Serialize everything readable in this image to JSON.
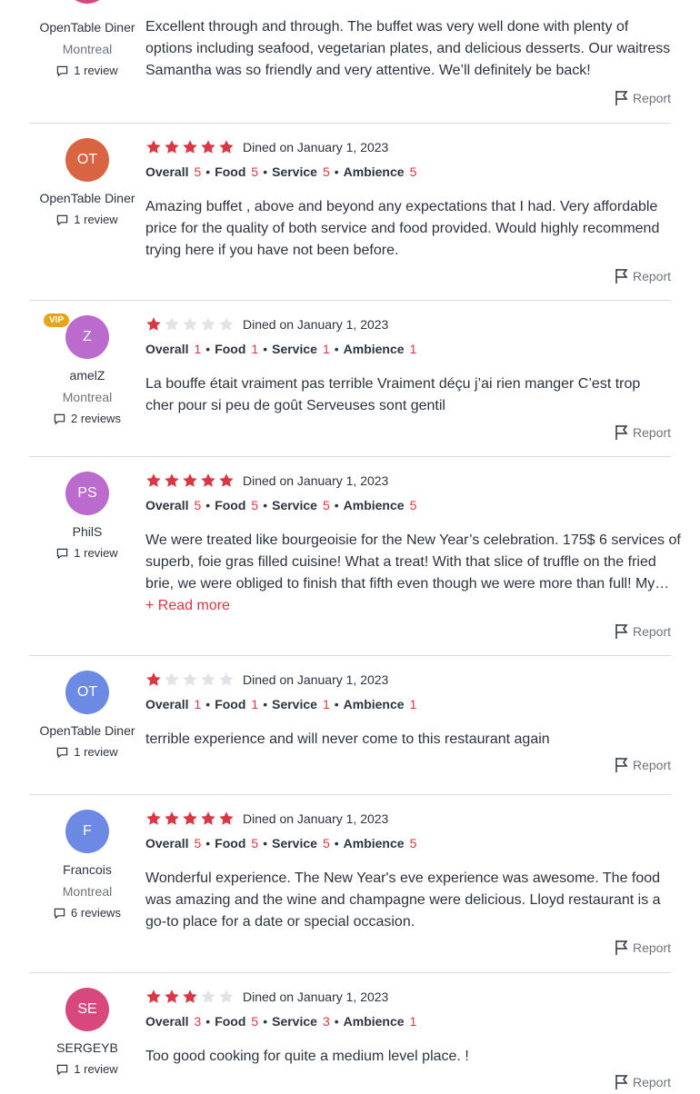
{
  "report_label": "Report",
  "read_more_label": "+ Read more",
  "rating_labels": {
    "overall": "Overall",
    "food": "Food",
    "service": "Service",
    "ambience": "Ambience"
  },
  "colors": {
    "star_filled": "#da3743",
    "star_empty": "#e1e3e6",
    "accent": "#da3743",
    "vip": "#e8a317"
  },
  "reviews": [
    {
      "avatar_initials": "",
      "avatar_color": "#d9487d",
      "name": "OpenTable Diner",
      "location": "Montreal",
      "review_count": "1 review",
      "vip": false,
      "text": "Excellent through and through. The buffet was very well done with plenty of options including seafood, vegetarian plates, and delicious desserts. Our waitress Samantha was so friendly and very attentive. We’ll definitely be back!"
    },
    {
      "avatar_initials": "OT",
      "avatar_color": "#d86441",
      "name": "OpenTable Diner",
      "review_count": "1 review",
      "stars": 5,
      "dined": "Dined on January 1, 2023",
      "overall": "5",
      "food": "5",
      "service": "5",
      "ambience": "5",
      "text": "Amazing buffet , above and beyond any expectations that I had. Very affordable price for the quality of both service and food provided. Would highly recommend trying here if you have not been before."
    },
    {
      "avatar_initials": "Z",
      "avatar_color": "#bb6acd",
      "name": "amelZ",
      "location": "Montreal",
      "review_count": "2 reviews",
      "vip": true,
      "vip_label": "VIP",
      "stars": 1,
      "dined": "Dined on January 1, 2023",
      "overall": "1",
      "food": "1",
      "service": "1",
      "ambience": "1",
      "text": "La bouffe était vraiment pas terrible Vraiment déçu j’ai rien manger C’est trop cher pour si peu de goût Serveuses sont gentil"
    },
    {
      "avatar_initials": "PS",
      "avatar_color": "#bb6acd",
      "name": "PhilS",
      "review_count": "1 review",
      "stars": 5,
      "dined": "Dined on January 1, 2023",
      "overall": "5",
      "food": "5",
      "service": "5",
      "ambience": "5",
      "text_lines": [
        "We were treated like bourgeoisie for the New Year’s celebration. 175$ 6 services of",
        "superb, foie gras filled cuisine! What a treat! With that slice of truffle on the fried",
        "brie, we were obliged to finish that fifth even though we were more than full! My…"
      ],
      "read_more": true
    },
    {
      "avatar_initials": "OT",
      "avatar_color": "#6c8ae4",
      "name": "OpenTable Diner",
      "review_count": "1 review",
      "stars": 1,
      "dined": "Dined on January 1, 2023",
      "overall": "1",
      "food": "1",
      "service": "1",
      "ambience": "1",
      "text": "terrible experience and will never come to this restaurant again"
    },
    {
      "avatar_initials": "F",
      "avatar_color": "#6c8ae4",
      "name": "Francois",
      "location": "Montreal",
      "review_count": "6 reviews",
      "stars": 5,
      "dined": "Dined on January 1, 2023",
      "overall": "5",
      "food": "5",
      "service": "5",
      "ambience": "5",
      "text": "Wonderful experience. The New Year's eve experience was awesome. The food was amazing and the wine and champagne were delicious. Lloyd restaurant is a go-to place for a date or special occasion."
    },
    {
      "avatar_initials": "SE",
      "avatar_color": "#d9487d",
      "name": "SERGEYB",
      "review_count": "1 review",
      "stars": 3,
      "dined": "Dined on January 1, 2023",
      "overall": "3",
      "food": "5",
      "service": "3",
      "ambience": "1",
      "text": "Too good cooking for quite a medium level place. !"
    }
  ]
}
